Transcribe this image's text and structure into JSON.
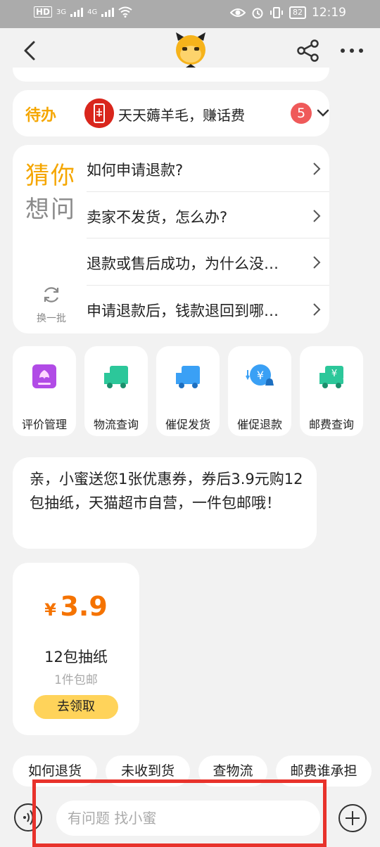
{
  "status_bar": {
    "network_label": "HD",
    "signal_1": "3G",
    "signal_2": "4G",
    "battery": "82",
    "time": "12:19"
  },
  "header": {
    "back_icon": "chevron-left-icon",
    "logo_icon": "xiaomi-mascot-icon",
    "share_icon": "share-icon",
    "more_icon": "more-dots-icon"
  },
  "todo": {
    "tag": "待办",
    "title": "天天薅羊毛，赚话费",
    "badge_count": "5"
  },
  "guess": {
    "title_line1": "猜你",
    "title_line2": "想问",
    "refresh_label": "换一批",
    "questions": [
      "如何申请退款?",
      "卖家不发货，怎么办?",
      "退款或售后成功，为什么没…",
      "申请退款后，钱款退回到哪…"
    ]
  },
  "tools": [
    {
      "label": "评价管理",
      "icon": "review-icon",
      "color": "#b14be6"
    },
    {
      "label": "物流查询",
      "icon": "truck-icon",
      "color": "#2cc79a"
    },
    {
      "label": "催促发货",
      "icon": "truck-icon",
      "color": "#3aa0f5"
    },
    {
      "label": "催促退款",
      "icon": "refund-bell-icon",
      "color": "#3aa0f5"
    },
    {
      "label": "邮费查询",
      "icon": "truck-yen-icon",
      "color": "#2cc79a"
    }
  ],
  "message": {
    "text": "亲，小蜜送您1张优惠券，券后3.9元购12包抽纸，天猫超市自营，一件包邮哦！"
  },
  "coupon": {
    "currency": "¥",
    "price": "3.9",
    "name": "12包抽纸",
    "sub": "1件包邮",
    "button": "去领取",
    "accent": "#f57300",
    "button_color": "#ffd35a"
  },
  "quick_replies": [
    "如何退货",
    "未收到货",
    "查物流",
    "邮费谁承担"
  ],
  "input": {
    "placeholder": "有问题 找小蜜",
    "voice_icon": "voice-icon",
    "plus_icon": "plus-icon"
  }
}
